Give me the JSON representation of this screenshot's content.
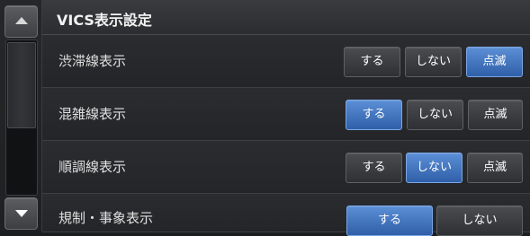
{
  "header": {
    "title": "VICS表示設定"
  },
  "scroll": {
    "up_icon": "triangle-up",
    "down_icon": "triangle-down"
  },
  "rows": [
    {
      "label": "渋滞線表示",
      "options": [
        "する",
        "しない",
        "点滅"
      ],
      "selected": "点滅"
    },
    {
      "label": "混雑線表示",
      "options": [
        "する",
        "しない",
        "点滅"
      ],
      "selected": "する"
    },
    {
      "label": "順調線表示",
      "options": [
        "する",
        "しない",
        "点滅"
      ],
      "selected": "しない"
    },
    {
      "label": "規制・事象表示",
      "options": [
        "する",
        "しない"
      ],
      "selected": "する"
    }
  ],
  "colors": {
    "accent": "#3e72c0",
    "background": "#1c1d1f"
  }
}
